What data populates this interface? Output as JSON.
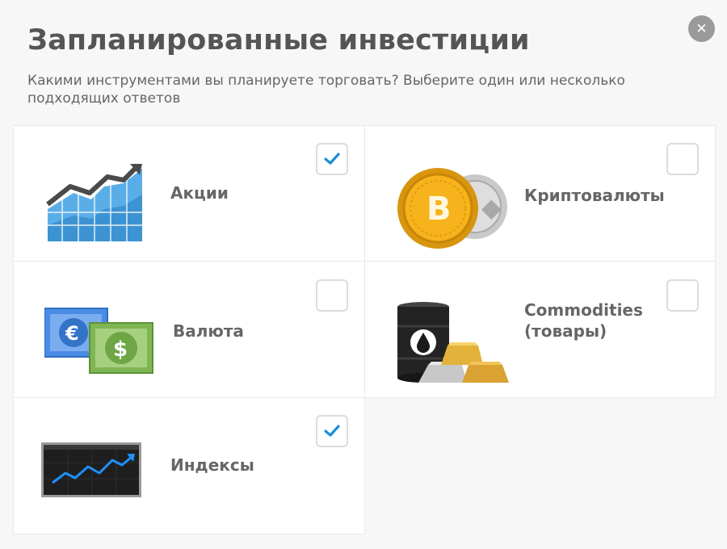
{
  "dialog": {
    "title": "Запланированные инвестиции",
    "subtitle": "Какими инструментами вы планируете торговать? Выберите один или несколько подходящих ответов",
    "close_icon": "close-icon"
  },
  "options": [
    {
      "id": "stocks",
      "label": "Акции",
      "checked": true,
      "icon": "stock-chart-icon"
    },
    {
      "id": "crypto",
      "label": "Криптовалюты",
      "checked": false,
      "icon": "crypto-coins-icon"
    },
    {
      "id": "currency",
      "label": "Валюта",
      "checked": false,
      "icon": "banknotes-icon"
    },
    {
      "id": "commodities",
      "label_line1": "Commodities",
      "label_line2": "(товары)",
      "checked": false,
      "icon": "oil-barrel-gold-icon"
    },
    {
      "id": "indices",
      "label": "Индексы",
      "checked": true,
      "icon": "index-monitor-icon"
    }
  ],
  "colors": {
    "check_accent": "#1a8fd6",
    "close_bg": "#9a9a9a"
  }
}
